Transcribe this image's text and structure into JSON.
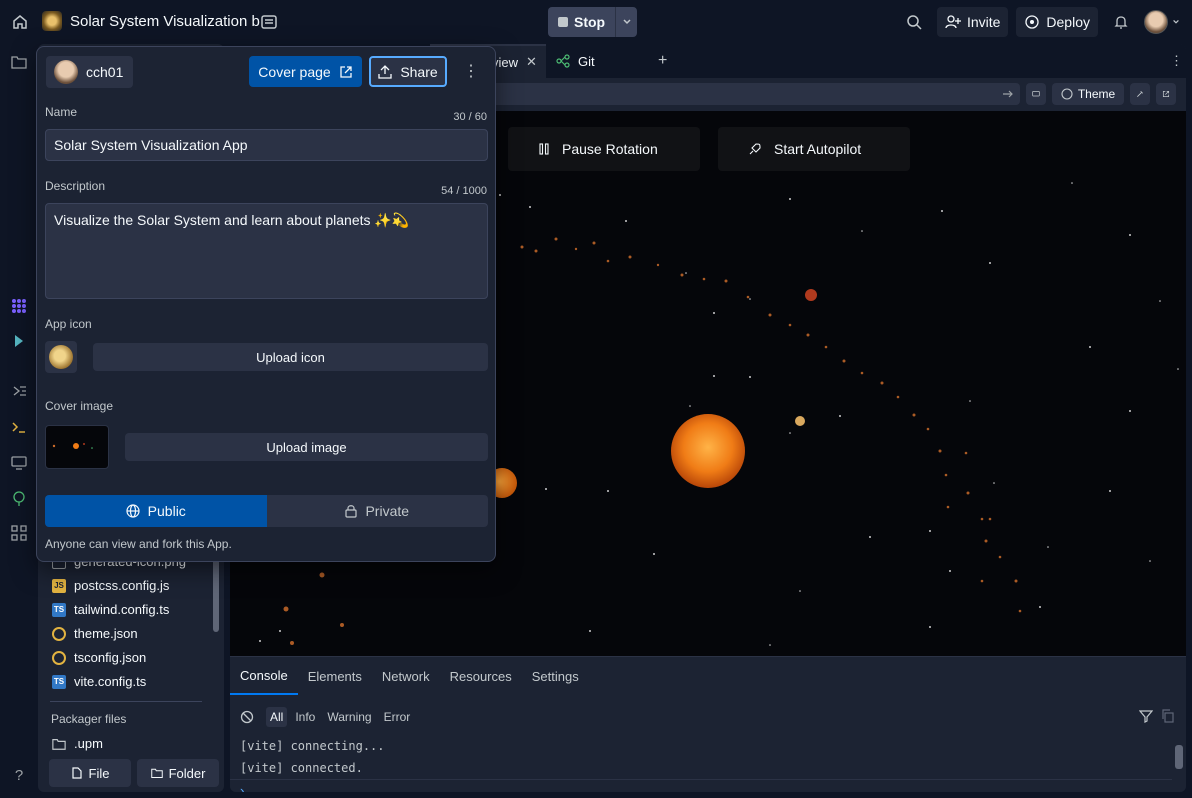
{
  "app": {
    "title": "Solar System Visualization b",
    "stop_label": "Stop",
    "invite_label": "Invite",
    "deploy_label": "Deploy"
  },
  "files": [
    {
      "name": "generated-icon.png",
      "icon": "image-icon"
    },
    {
      "name": "postcss.config.js",
      "icon": "js-file-icon"
    },
    {
      "name": "tailwind.config.ts",
      "icon": "ts-file-icon"
    },
    {
      "name": "theme.json",
      "icon": "json-file-icon"
    },
    {
      "name": "tsconfig.json",
      "icon": "json-file-icon"
    },
    {
      "name": "vite.config.ts",
      "icon": "ts-file-icon"
    }
  ],
  "packager": {
    "label": "Packager files",
    "upm": ".upm"
  },
  "file_actions": {
    "file_label": "File",
    "folder_label": "Folder"
  },
  "tabs": [
    {
      "label": "view",
      "closable": true
    },
    {
      "label": "Git",
      "closable": false
    }
  ],
  "urlbar": {
    "theme_label": "Theme"
  },
  "preview": {
    "pause_label": "Pause Rotation",
    "autopilot_label": "Start Autopilot"
  },
  "devtools": {
    "tabs": [
      "Console",
      "Elements",
      "Network",
      "Resources",
      "Settings"
    ],
    "active_tab": "Console",
    "filters": [
      "All",
      "Info",
      "Warning",
      "Error"
    ],
    "active_filter": "All",
    "lines": [
      "[vite] connecting...",
      "[vite] connected."
    ]
  },
  "share_panel": {
    "username": "cch01",
    "cover_page_label": "Cover page",
    "share_label": "Share",
    "name_label": "Name",
    "name_count": "30 / 60",
    "name_value": "Solar System Visualization App",
    "description_label": "Description",
    "description_count": "54 / 1000",
    "description_value": "Visualize the Solar System and learn about planets ✨💫",
    "app_icon_label": "App icon",
    "upload_icon_label": "Upload icon",
    "cover_image_label": "Cover image",
    "upload_image_label": "Upload image",
    "public_label": "Public",
    "private_label": "Private",
    "visibility": "Public",
    "hint": "Anyone can view and fork this App."
  },
  "colors": {
    "accent": "#0053a6",
    "focus": "#57abff",
    "bg": "#0e1525",
    "surface": "#1c2333"
  }
}
